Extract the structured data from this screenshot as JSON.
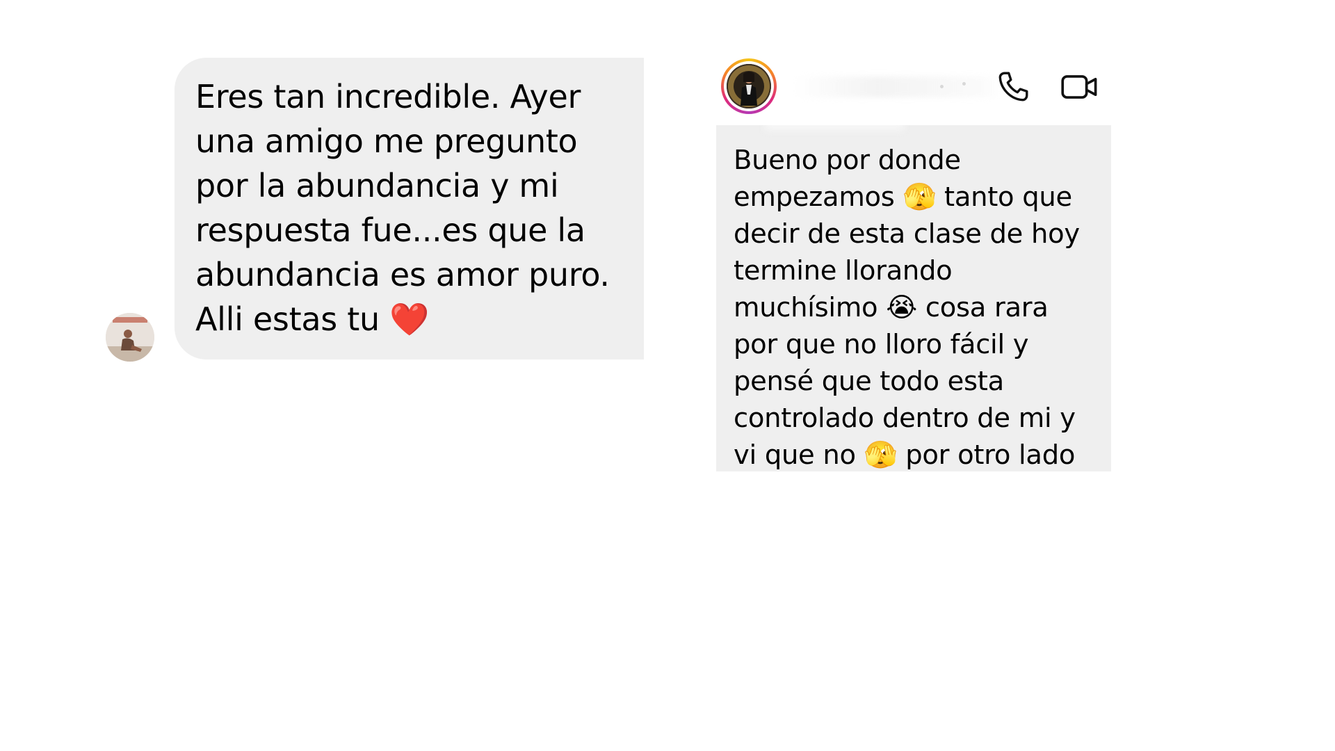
{
  "left_message": {
    "text": "Eres tan incredible. Ayer\nuna amigo me pregunto\npor la abundancia y mi\nrespuesta fue...es que la\nabundancia es amor puro.\nAlli estas tu ❤️"
  },
  "right_chat": {
    "header": {
      "call_icon": "phone-icon",
      "video_icon": "video-camera-icon"
    },
    "message": {
      "text": "Bueno por donde\nempezamos 🫣 tanto que\ndecir de esta clase de hoy\ntermine llorando\nmuchísimo 😭 cosa rara\npor que no lloro fácil y\npensé que todo esta\ncontrolado dentro de mi y\nvi que no 🫣 por otro lado"
    }
  },
  "colors": {
    "bubble_bg": "#efefef",
    "story_ring": "#dd2a7b"
  }
}
